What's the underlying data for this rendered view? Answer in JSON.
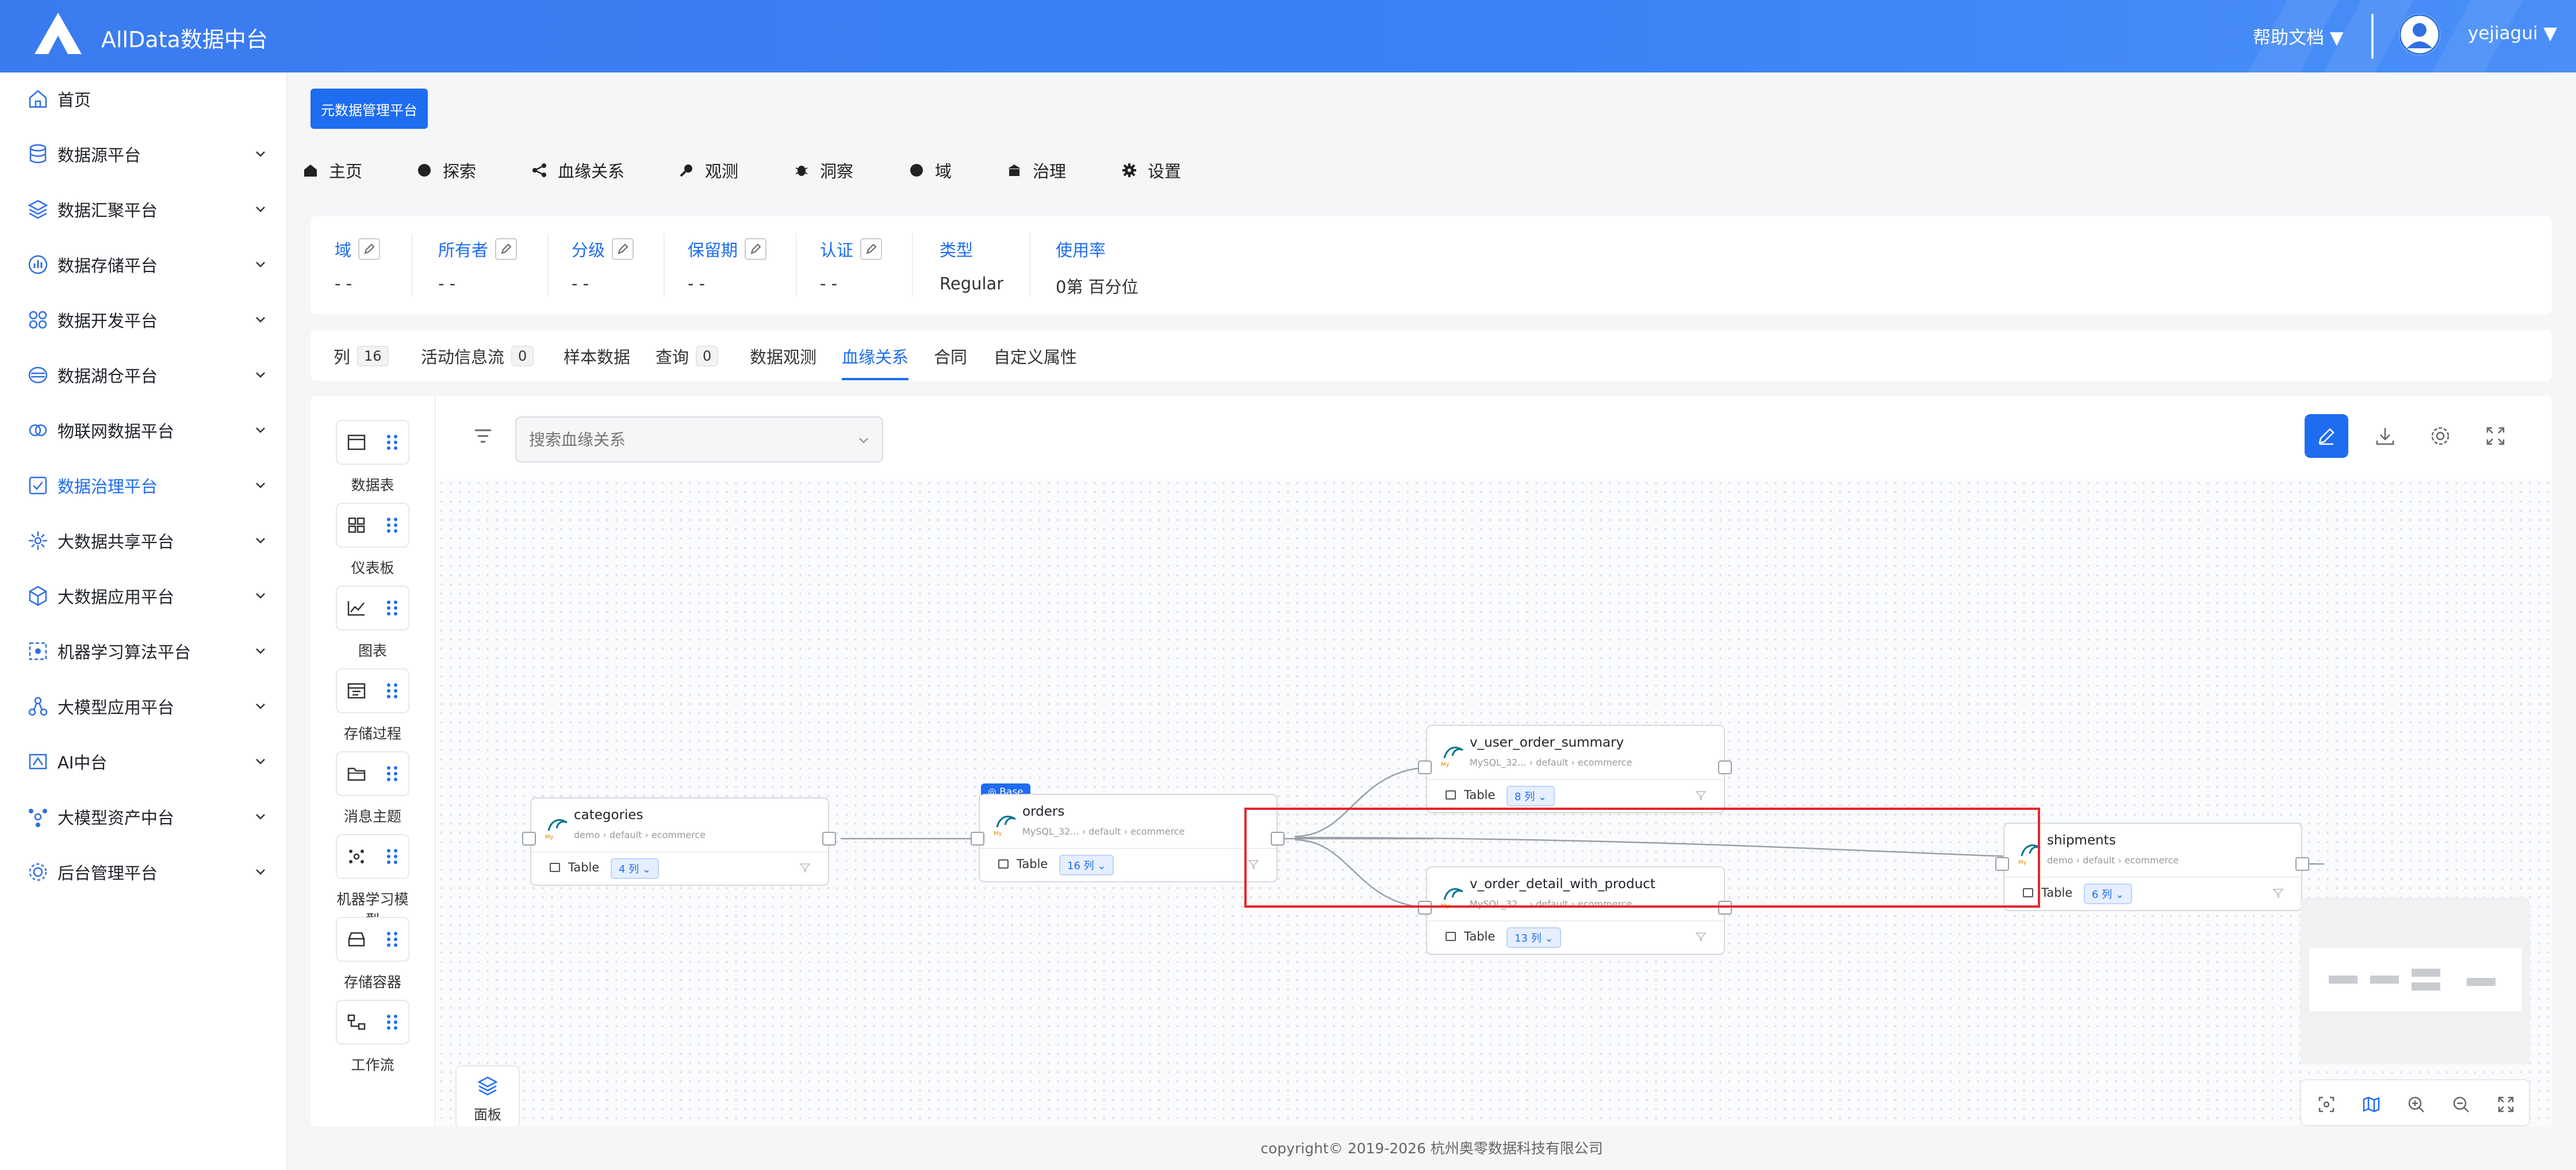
{
  "app": {
    "title": "AllData数据中台",
    "help": "帮助文档 ▼",
    "user": "yejiagui ▼"
  },
  "sidebar": {
    "items": [
      {
        "label": "首页",
        "icon": "home-icon"
      },
      {
        "label": "数据源平台",
        "icon": "database-icon"
      },
      {
        "label": "数据汇聚平台",
        "icon": "layers-icon"
      },
      {
        "label": "数据存储平台",
        "icon": "bar-chart-icon"
      },
      {
        "label": "数据开发平台",
        "icon": "grid-icon"
      },
      {
        "label": "数据湖仓平台",
        "icon": "lake-icon"
      },
      {
        "label": "物联网数据平台",
        "icon": "link-icon"
      },
      {
        "label": "数据治理平台",
        "icon": "governance-icon",
        "active": true
      },
      {
        "label": "大数据共享平台",
        "icon": "share-icon"
      },
      {
        "label": "大数据应用平台",
        "icon": "cube-icon"
      },
      {
        "label": "机器学习算法平台",
        "icon": "ml-icon"
      },
      {
        "label": "大模型应用平台",
        "icon": "model-icon"
      },
      {
        "label": "AI中台",
        "icon": "ai-icon"
      },
      {
        "label": "大模型资产中台",
        "icon": "asset-icon"
      },
      {
        "label": "后台管理平台",
        "icon": "settings-icon"
      }
    ]
  },
  "header": {
    "button": "元数据管理平台"
  },
  "nav": [
    {
      "label": "主页",
      "icon": "home-icon"
    },
    {
      "label": "探索",
      "icon": "explore-icon"
    },
    {
      "label": "血缘关系",
      "icon": "lineage-icon"
    },
    {
      "label": "观测",
      "icon": "observe-icon"
    },
    {
      "label": "洞察",
      "icon": "insight-icon"
    },
    {
      "label": "域",
      "icon": "domain-icon"
    },
    {
      "label": "治理",
      "icon": "governance-icon"
    },
    {
      "label": "设置",
      "icon": "gear-icon"
    }
  ],
  "info": [
    {
      "key": "域",
      "value": "- -",
      "editable": true
    },
    {
      "key": "所有者",
      "value": "- -",
      "editable": true
    },
    {
      "key": "分级",
      "value": "- -",
      "editable": true
    },
    {
      "key": "保留期",
      "value": "- -",
      "editable": true
    },
    {
      "key": "认证",
      "value": "- -",
      "editable": true
    },
    {
      "key": "类型",
      "value": "Regular",
      "editable": false
    },
    {
      "key": "使用率",
      "value": "0第 百分位",
      "editable": false
    }
  ],
  "tabs": [
    {
      "label": "列",
      "count": "16"
    },
    {
      "label": "活动信息流",
      "count": "0"
    },
    {
      "label": "样本数据"
    },
    {
      "label": "查询",
      "count": "0"
    },
    {
      "label": "数据观测"
    },
    {
      "label": "血缘关系",
      "active": true
    },
    {
      "label": "合同"
    },
    {
      "label": "自定义属性"
    }
  ],
  "palette": [
    {
      "label": "数据表",
      "icon": "table-icon"
    },
    {
      "label": "仪表板",
      "icon": "dashboard-icon"
    },
    {
      "label": "图表",
      "icon": "chart-icon"
    },
    {
      "label": "存储过程",
      "icon": "procedure-icon"
    },
    {
      "label": "消息主题",
      "icon": "topic-icon"
    },
    {
      "label": "机器学习模型",
      "icon": "ml-model-icon"
    },
    {
      "label": "存储容器",
      "icon": "container-icon"
    },
    {
      "label": "工作流",
      "icon": "workflow-icon"
    }
  ],
  "search": {
    "placeholder": "搜索血缘关系"
  },
  "panel": {
    "label": "面板"
  },
  "nodes": {
    "categories": {
      "name": "categories",
      "path": "demo  ›  default  ›  ecommerce",
      "type": "Table",
      "cols": "4 列 ⌄"
    },
    "orders": {
      "name": "orders",
      "path": "MySQL_32...  ›  default  ›  ecommerce",
      "type": "Table",
      "cols": "16 列 ⌄",
      "badge": "◎ Base"
    },
    "v_user_order_summary": {
      "name": "v_user_order_summary",
      "path": "MySQL_32...  ›  default  ›  ecommerce",
      "type": "Table",
      "cols": "8 列 ⌄"
    },
    "v_order_detail_with_product": {
      "name": "v_order_detail_with_product",
      "path": "MySQL_32...  ›  default  ›  ecommerce",
      "type": "Table",
      "cols": "13 列 ⌄"
    },
    "shipments": {
      "name": "shipments",
      "path": "demo  ›  default  ›  ecommerce",
      "type": "Table",
      "cols": "6 列 ⌄"
    }
  },
  "footer": {
    "text": "copyright© 2019-2026 杭州奥零数据科技有限公司"
  },
  "colors": {
    "primary": "#1e6cf0",
    "highlight": "#e5262f",
    "topbar": "#3b7bf0"
  }
}
